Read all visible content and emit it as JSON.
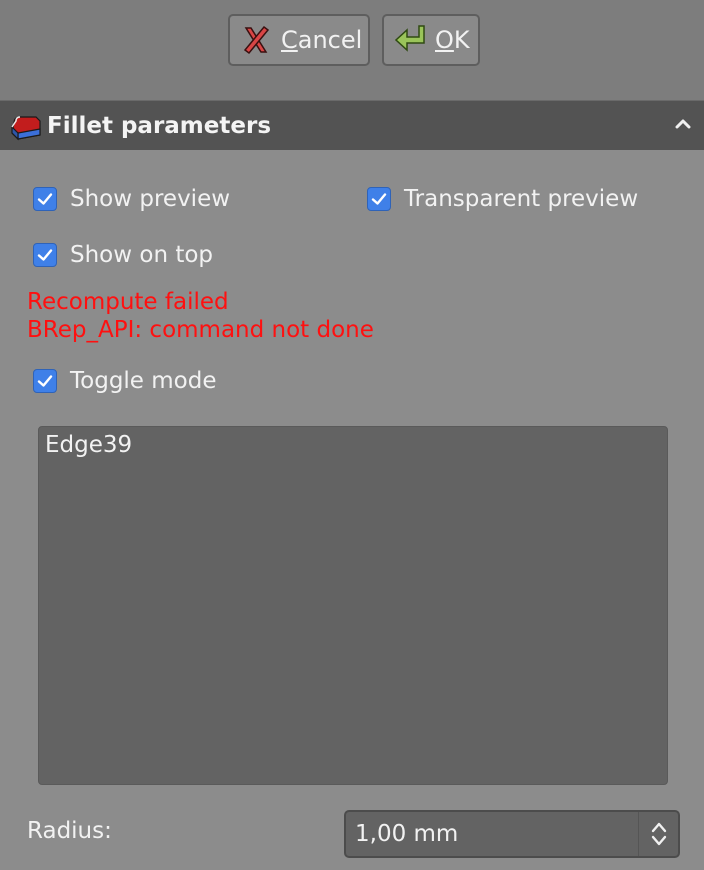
{
  "buttons": {
    "cancel": {
      "mnemonic": "C",
      "rest": "ancel"
    },
    "ok": {
      "mnemonic": "O",
      "rest": "K"
    }
  },
  "panel": {
    "title": "Fillet parameters",
    "icon": "fillet-icon",
    "collapse_icon": "chevron-up-icon"
  },
  "options": {
    "show_preview": {
      "label": "Show preview",
      "checked": true
    },
    "transparent_preview": {
      "label": "Transparent preview",
      "checked": true
    },
    "show_on_top": {
      "label": "Show on top",
      "checked": true
    },
    "toggle_mode": {
      "label": "Toggle mode",
      "checked": true
    }
  },
  "error": {
    "line1": "Recompute failed",
    "line2": "BRep_API: command not done",
    "color": "#ff1010"
  },
  "references": {
    "items": [
      "Edge39"
    ]
  },
  "radius": {
    "label": "Radius:",
    "value": "1,00 mm"
  },
  "colors": {
    "accent": "#3f80e8",
    "header_bg": "#535353",
    "panel_bg": "#8c8c8c"
  }
}
